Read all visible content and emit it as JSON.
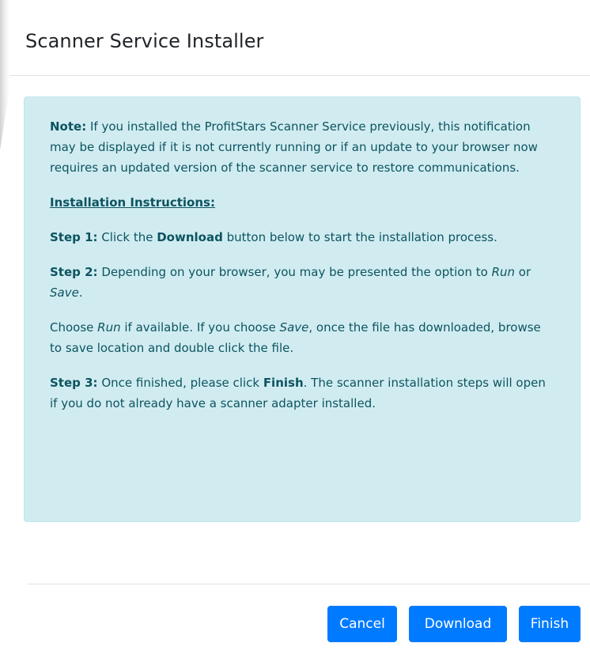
{
  "dialog": {
    "title": "Scanner Service Installer"
  },
  "note": {
    "label": "Note:",
    "text": " If you installed the ProfitStars Scanner Service previously, this notification may be displayed if it is not currently running or if an update to your browser now requires an updated version of the scanner service to restore communications."
  },
  "instructions_heading": "Installation Instructions:",
  "step1": {
    "label": "Step 1:",
    "text_before": " Click the ",
    "bold": "Download",
    "text_after": " button below to start the installation process."
  },
  "step2": {
    "label": "Step 2:",
    "text_before": " Depending on your browser, you may be presented the option to ",
    "run": "Run",
    "or": " or ",
    "save": "Save",
    "end": "."
  },
  "choose": {
    "text1": "Choose ",
    "run": "Run",
    "text2": " if available. If you choose ",
    "save": "Save",
    "text3": ", once the file has downloaded, browse to save location and double click the file."
  },
  "step3": {
    "label": "Step 3:",
    "text_before": " Once finished, please click ",
    "bold": "Finish",
    "text_after": ". The scanner installation steps will open if you do not already have a scanner adapter installed."
  },
  "footer": {
    "cancel_label": "Cancel",
    "download_label": "Download",
    "finish_label": "Finish"
  },
  "colors": {
    "primary": "#007bff",
    "alert_bg": "#d1ecf1",
    "alert_text": "#0c5460",
    "alert_border": "#bee5eb"
  }
}
